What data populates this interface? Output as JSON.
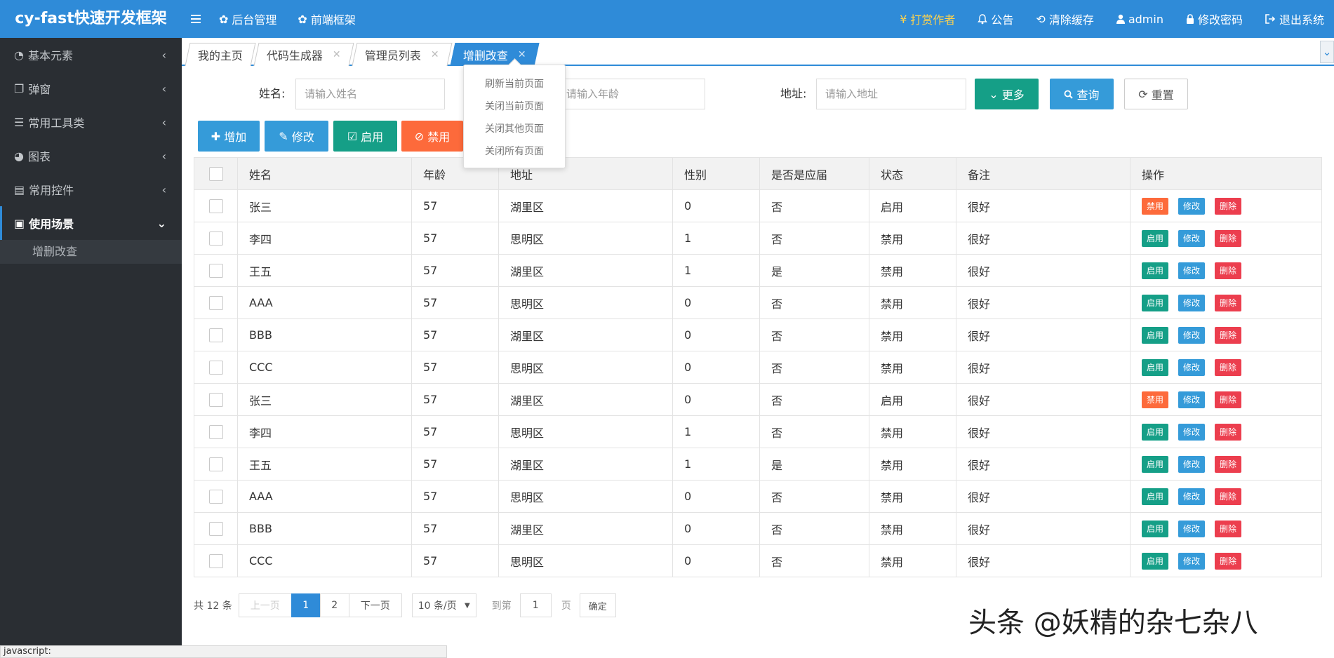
{
  "header": {
    "brand": "cy-fast快速开发框架",
    "menu_toggle_icon": "menu-icon",
    "left_nav": [
      {
        "label": "后台管理",
        "icon": "gear-icon"
      },
      {
        "label": "前端框架",
        "icon": "gear-icon"
      }
    ],
    "right_nav": [
      {
        "label": "打赏作者",
        "icon": "yen-icon"
      },
      {
        "label": "公告",
        "icon": "bell-icon"
      },
      {
        "label": "清除缓存",
        "icon": "refresh-icon"
      },
      {
        "label": "admin",
        "icon": "user-icon"
      },
      {
        "label": "修改密码",
        "icon": "lock-icon"
      },
      {
        "label": "退出系统",
        "icon": "sign-out-icon"
      }
    ]
  },
  "sidebar": {
    "items": [
      {
        "label": "基本元素",
        "icon": "dashboard-icon"
      },
      {
        "label": "弹窗",
        "icon": "clone-icon"
      },
      {
        "label": "常用工具类",
        "icon": "css3-icon"
      },
      {
        "label": "图表",
        "icon": "pie-chart-icon"
      },
      {
        "label": "常用控件",
        "icon": "archive-icon"
      },
      {
        "label": "使用场景",
        "icon": "id-card-icon"
      }
    ],
    "sub_item": "增删改查"
  },
  "tabs": [
    {
      "label": "我的主页"
    },
    {
      "label": "代码生成器"
    },
    {
      "label": "管理员列表"
    },
    {
      "label": "增删改查"
    }
  ],
  "context_menu": [
    "刷新当前页面",
    "关闭当前页面",
    "关闭其他页面",
    "关闭所有页面"
  ],
  "search": {
    "name_label": "姓名:",
    "name_placeholder": "请输入姓名",
    "age_placeholder": "请输入年龄",
    "address_label": "地址:",
    "address_placeholder": "请输入地址",
    "more_label": "更多",
    "query_label": "查询",
    "reset_label": "重置"
  },
  "toolbar": {
    "add_label": "增加",
    "edit_label": "修改",
    "enable_label": "启用",
    "disable_label": "禁用"
  },
  "table": {
    "headers": [
      "姓名",
      "年龄",
      "地址",
      "性别",
      "是否是应届",
      "状态",
      "备注",
      "操作"
    ],
    "action_labels": {
      "enable": "启用",
      "disable": "禁用",
      "edit": "修改",
      "delete": "删除"
    },
    "rows": [
      {
        "name": "张三",
        "age": "57",
        "address": "湖里区",
        "gender": "0",
        "graduate": "否",
        "status": "启用",
        "note": "很好",
        "enabled": true
      },
      {
        "name": "李四",
        "age": "57",
        "address": "思明区",
        "gender": "1",
        "graduate": "否",
        "status": "禁用",
        "note": "很好",
        "enabled": false
      },
      {
        "name": "王五",
        "age": "57",
        "address": "湖里区",
        "gender": "1",
        "graduate": "是",
        "status": "禁用",
        "note": "很好",
        "enabled": false
      },
      {
        "name": "AAA",
        "age": "57",
        "address": "思明区",
        "gender": "0",
        "graduate": "否",
        "status": "禁用",
        "note": "很好",
        "enabled": false
      },
      {
        "name": "BBB",
        "age": "57",
        "address": "湖里区",
        "gender": "0",
        "graduate": "否",
        "status": "禁用",
        "note": "很好",
        "enabled": false
      },
      {
        "name": "CCC",
        "age": "57",
        "address": "思明区",
        "gender": "0",
        "graduate": "否",
        "status": "禁用",
        "note": "很好",
        "enabled": false
      },
      {
        "name": "张三",
        "age": "57",
        "address": "湖里区",
        "gender": "0",
        "graduate": "否",
        "status": "启用",
        "note": "很好",
        "enabled": true
      },
      {
        "name": "李四",
        "age": "57",
        "address": "思明区",
        "gender": "1",
        "graduate": "否",
        "status": "禁用",
        "note": "很好",
        "enabled": false
      },
      {
        "name": "王五",
        "age": "57",
        "address": "湖里区",
        "gender": "1",
        "graduate": "是",
        "status": "禁用",
        "note": "很好",
        "enabled": false
      },
      {
        "name": "AAA",
        "age": "57",
        "address": "思明区",
        "gender": "0",
        "graduate": "否",
        "status": "禁用",
        "note": "很好",
        "enabled": false
      },
      {
        "name": "BBB",
        "age": "57",
        "address": "湖里区",
        "gender": "0",
        "graduate": "否",
        "status": "禁用",
        "note": "很好",
        "enabled": false
      },
      {
        "name": "CCC",
        "age": "57",
        "address": "思明区",
        "gender": "0",
        "graduate": "否",
        "status": "禁用",
        "note": "很好",
        "enabled": false
      }
    ]
  },
  "pagination": {
    "total": "共 12 条",
    "prev": "上一页",
    "pages": [
      "1",
      "2"
    ],
    "current_page": "1",
    "next": "下一页",
    "page_size": "10 条/页",
    "goto_label": "到第",
    "goto_value": "1",
    "page_unit": "页",
    "confirm": "确定"
  },
  "watermark": "头条 @妖精的杂七杂八",
  "statusbar": "javascript:",
  "colors": {
    "primary": "#2f8bd8",
    "sidebar": "#2a2e33",
    "green": "#159f87",
    "orange": "#fd6a3b",
    "red": "#ec3e4e",
    "status_on": "#1a9e3c",
    "status_off": "#e8343e"
  }
}
